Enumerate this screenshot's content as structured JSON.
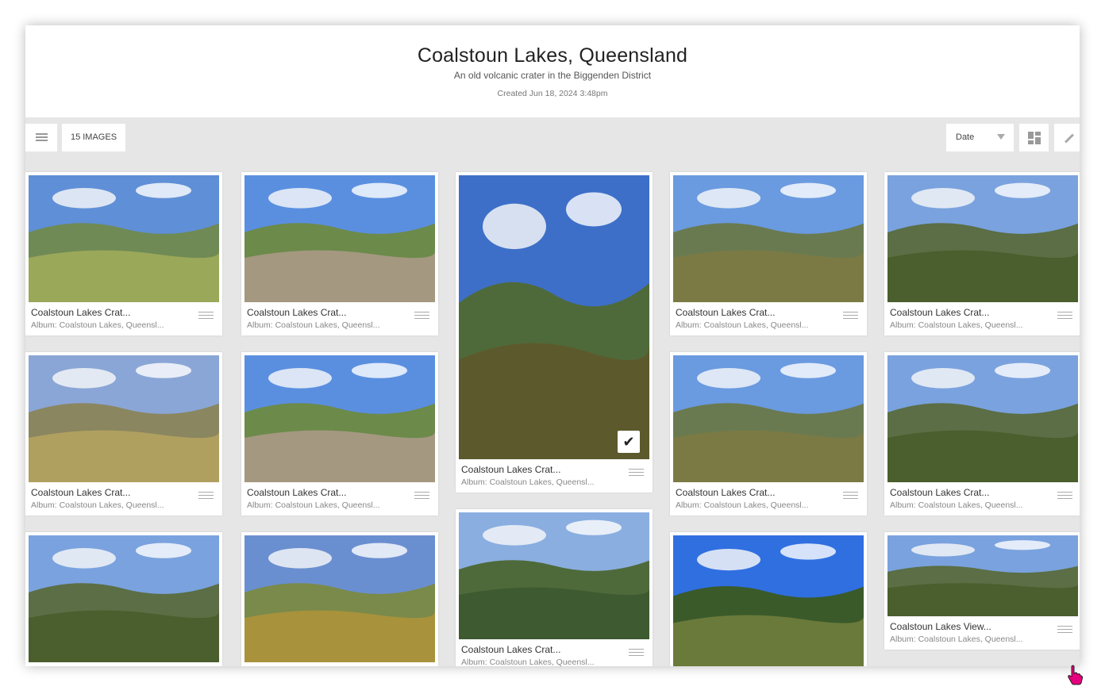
{
  "gallery": {
    "title": "Coalstoun Lakes, Queensland",
    "subtitle": "An old volcanic crater in the Biggenden District",
    "created": "Created Jun 18, 2024 3:48pm"
  },
  "toolbar": {
    "menu_icon": "hamburger-menu-icon",
    "image_count": "15 IMAGES",
    "sort_label": "Date",
    "layout_icon": "grid-layout-icon",
    "edit_icon": "pencil-icon"
  },
  "colors": {
    "accent": "#e6007e",
    "background": "#e6e6e6"
  },
  "images": [
    {
      "title": "Coalstoun Lakes Crat...",
      "album": "Album: Coalstoun Lakes, Queensl..."
    },
    {
      "title": "Coalstoun Lakes Crat...",
      "album": "Album: Coalstoun Lakes, Queensl..."
    },
    {
      "title": "Coalstoun Lakes Crat...",
      "album": "Album: Coalstoun Lakes, Queensl...",
      "selected": true
    },
    {
      "title": "Coalstoun Lakes Crat...",
      "album": "Album: Coalstoun Lakes, Queensl..."
    },
    {
      "title": "Coalstoun Lakes Crat...",
      "album": "Album: Coalstoun Lakes, Queensl..."
    },
    {
      "title": "Coalstoun Lakes Crat...",
      "album": "Album: Coalstoun Lakes, Queensl..."
    },
    {
      "title": "Coalstoun Lakes Crat...",
      "album": "Album: Coalstoun Lakes, Queensl..."
    },
    {
      "title": "Coalstoun Lakes Crat...",
      "album": "Album: Coalstoun Lakes, Queensl..."
    },
    {
      "title": "Coalstoun Lakes Crat...",
      "album": "Album: Coalstoun Lakes, Queensl..."
    },
    {
      "title": "Coalstoun Lakes Crat...",
      "album": "Album: Coalstoun Lakes, Queensl..."
    },
    {
      "title": "",
      "album": ""
    },
    {
      "title": "Coalstoun Lakes Crat...",
      "album": "Album: Coalstoun Lakes, Queensl..."
    },
    {
      "title": "",
      "album": ""
    },
    {
      "title": "Coalstoun Lakes View...",
      "album": "Album: Coalstoun Lakes, Queensl..."
    },
    {
      "title": "",
      "album": ""
    }
  ]
}
